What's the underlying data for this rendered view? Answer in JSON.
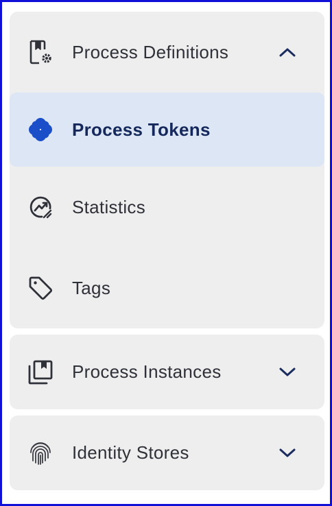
{
  "nav": {
    "process_definitions": {
      "label": "Process Definitions",
      "icon": "process-definitions-icon",
      "expanded": true,
      "items": [
        {
          "label": "Process Tokens",
          "icon": "flower-icon",
          "active": true
        },
        {
          "label": "Statistics",
          "icon": "statistics-icon",
          "active": false
        },
        {
          "label": "Tags",
          "icon": "tag-icon",
          "active": false
        }
      ]
    },
    "process_instances": {
      "label": "Process Instances",
      "icon": "process-instances-icon",
      "expanded": false
    },
    "identity_stores": {
      "label": "Identity Stores",
      "icon": "fingerprint-icon",
      "expanded": false
    }
  },
  "colors": {
    "group_bg": "#efeeef",
    "active_bg": "#dde6f4",
    "active_text": "#15285b",
    "accent_blue": "#1b4fc9",
    "text": "#2f3138",
    "chevron": "#1b2d5e",
    "frame": "#1010d8"
  }
}
